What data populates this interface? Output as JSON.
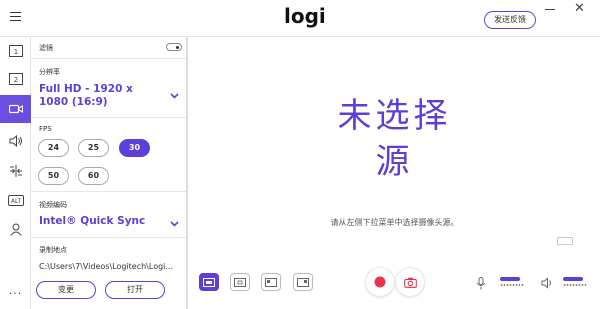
{
  "app": {
    "logo": "logi",
    "feedback_label": "发送反馈",
    "minimize_symbol": "—",
    "close_symbol": "✕"
  },
  "rail": {
    "items": [
      {
        "name": "layout-1",
        "label": "1",
        "active": false
      },
      {
        "name": "layout-2",
        "label": "2",
        "active": false
      },
      {
        "name": "camera",
        "label": "",
        "active": true
      },
      {
        "name": "audio",
        "label": "",
        "active": false
      },
      {
        "name": "transitions",
        "label": "",
        "active": false
      },
      {
        "name": "alt",
        "label": "ALT",
        "active": false
      },
      {
        "name": "account",
        "label": "",
        "active": false
      },
      {
        "name": "more",
        "label": "···",
        "active": false
      }
    ]
  },
  "settings": {
    "filter_label": "滤镜",
    "filter_enabled": false,
    "resolution_label": "分辨率",
    "resolution_value": "Full HD - 1920 x 1080 (16:9)",
    "fps_label": "FPS",
    "fps_options": [
      "24",
      "25",
      "30",
      "50",
      "60"
    ],
    "fps_selected": "30",
    "codec_label": "视频编码",
    "codec_value": "Intel® Quick Sync",
    "record_label": "录制地点",
    "record_path": "C:\\Users\\7\\Videos\\Logitech\\Logi...",
    "change_label": "变更",
    "open_label": "打开"
  },
  "main": {
    "title_line1": "未选择",
    "title_line2": "源",
    "subtitle": "请从左侧下拉菜单中选择摄像头源。"
  },
  "toolbar": {
    "layouts": [
      {
        "name": "layout-single",
        "active": true
      },
      {
        "name": "layout-dual",
        "active": false
      },
      {
        "name": "layout-pip-left",
        "active": false
      },
      {
        "name": "layout-pip-right",
        "active": false
      }
    ],
    "mic_level": 0.85,
    "speaker_level": 0.85
  },
  "colors": {
    "accent": "#5b3fd6",
    "record_red": "#e8344a"
  }
}
